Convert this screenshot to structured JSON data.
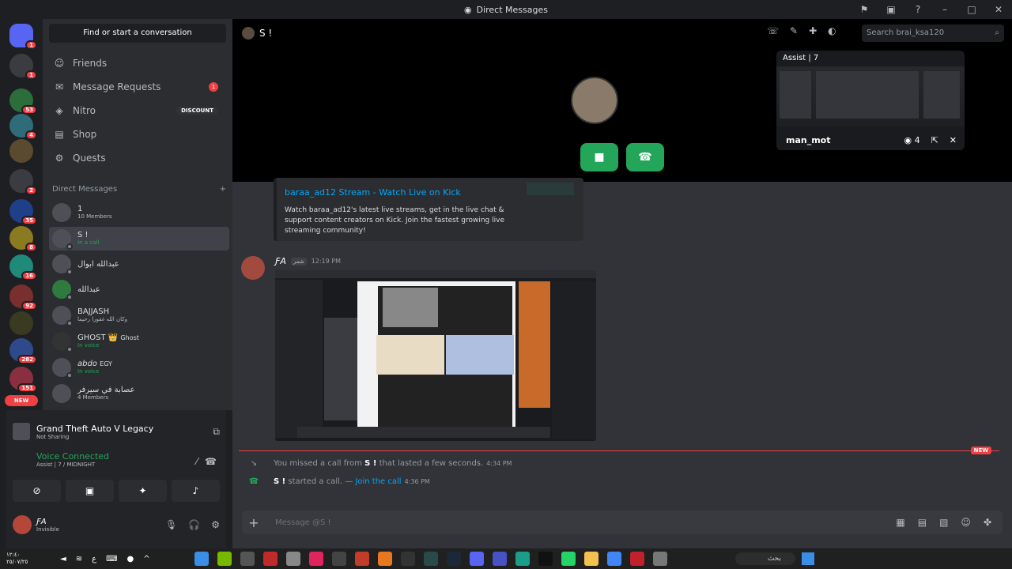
{
  "window": {
    "title": "Direct Messages"
  },
  "rail": {
    "badges": [
      "1",
      "1",
      "53",
      "4",
      "",
      "2",
      "35",
      "8",
      "16",
      "92",
      "",
      "282",
      "151"
    ],
    "new_label": "NEW"
  },
  "sidebar": {
    "find": "Find or start a conversation",
    "nav": [
      {
        "label": "Friends",
        "icon": "friends-icon"
      },
      {
        "label": "Message Requests",
        "icon": "mail-icon",
        "badge": "1"
      },
      {
        "label": "Nitro",
        "icon": "nitro-icon",
        "tag": "DISCOUNT"
      },
      {
        "label": "Shop",
        "icon": "shop-icon"
      },
      {
        "label": "Quests",
        "icon": "quests-icon"
      }
    ],
    "dm_header": "Direct Messages",
    "dms": [
      {
        "name": "1",
        "sub": "10 Members"
      },
      {
        "name": "S !",
        "sub": "In a call"
      },
      {
        "name": "عبدالله ابوال",
        "sub": ""
      },
      {
        "name": "عبدالله",
        "sub": ""
      },
      {
        "name": "BAJJASH",
        "sub": "وكان الله غفورا رحيما"
      },
      {
        "name": "GHOST",
        "sub": "In voice",
        "tag": "Ghost"
      },
      {
        "name": "abdo",
        "sub": "In voice",
        "tag": "EGY"
      },
      {
        "name": "عصابة في سيرفر",
        "sub": "4 Members"
      }
    ]
  },
  "panel": {
    "game": "Grand Theft Auto V Legacy",
    "game_status": "Not Sharing",
    "voice": "Voice Connected",
    "voice_channel": "Assist | 7 / MIDNIGHT",
    "user": "ƑA",
    "user_status": "Invisible"
  },
  "call": {
    "name": "S !",
    "search_placeholder": "Search brai_ksa120",
    "stream_title": "Assist | 7",
    "stream_user": "man_mot",
    "viewers": "4"
  },
  "embed": {
    "title": "baraa_ad12 Stream - Watch Live on Kick",
    "description": "Watch baraa_ad12's latest live streams, get in the live chat & support content creators on Kick. Join the fastest growing live streaming community!"
  },
  "message": {
    "author": "ƑA",
    "tag": "شمر",
    "time": "12:19 PM"
  },
  "divider_label": "NEW",
  "system": [
    {
      "pre": "You missed a call from ",
      "name": "S !",
      "post": " that lasted a few seconds.",
      "link": "",
      "time": "4:34 PM"
    },
    {
      "pre": "",
      "name": "S !",
      "post": " started a call. — ",
      "link": "Join the call",
      "time": "4:36 PM"
    }
  ],
  "composer": {
    "placeholder": "Message @S !"
  },
  "taskbar": {
    "clock": "١٢:٤٠",
    "date": "٢٥/٠٧/٢٥",
    "lang": "ع",
    "search": "بحث"
  },
  "colors": {
    "accent": "#5865f2",
    "green": "#23a55a",
    "red": "#f23f43",
    "link": "#00a8fc"
  }
}
